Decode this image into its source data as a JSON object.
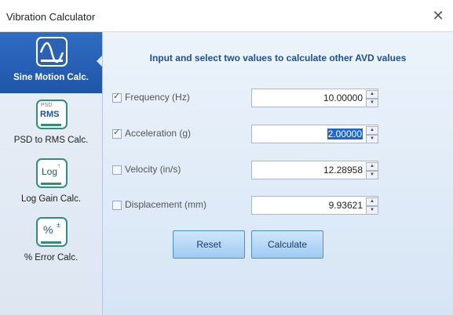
{
  "window": {
    "title": "Vibration Calculator",
    "close_glyph": "✕"
  },
  "sidebar": {
    "items": [
      {
        "label": "Sine Motion Calc.",
        "icon": "sine-wave-icon",
        "active": true
      },
      {
        "label": "PSD to RMS Calc.",
        "icon": "psd-rms-icon",
        "icon_text": "RMS",
        "icon_small": "PSD"
      },
      {
        "label": "Log Gain Calc.",
        "icon": "log-gain-icon",
        "icon_text": "Log"
      },
      {
        "label": "% Error Calc.",
        "icon": "percent-error-icon",
        "icon_text": "%"
      }
    ]
  },
  "main": {
    "instruction": "Input and select two values to calculate other AVD values",
    "fields": [
      {
        "label": "Frequency (Hz)",
        "checked": true,
        "value": "10.00000"
      },
      {
        "label": "Acceleration (g)",
        "checked": true,
        "value": "2.00000"
      },
      {
        "label": "Velocity (in/s)",
        "checked": false,
        "value": "12.28958"
      },
      {
        "label": "Displacement (mm)",
        "checked": false,
        "value": "9.93621"
      }
    ],
    "reset_label": "Reset",
    "calculate_label": "Calculate"
  },
  "colors": {
    "active_sidebar": "#2f6cc3",
    "icon_border": "#2f8f77",
    "instruction_text": "#1e4f95",
    "selection": "#1e66d0"
  }
}
